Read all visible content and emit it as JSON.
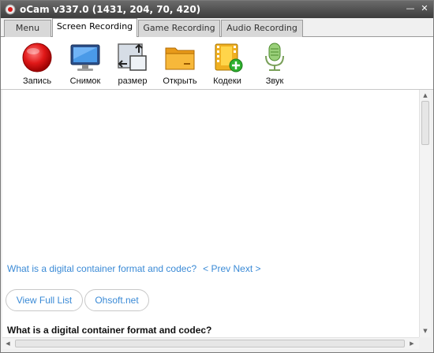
{
  "window": {
    "title": "oCam v337.0 (1431, 204, 70, 420)",
    "minimize_glyph": "—",
    "close_glyph": "✕",
    "icon": "ocam-app-icon"
  },
  "tabs": [
    {
      "label": "Menu",
      "active": false
    },
    {
      "label": "Screen Recording",
      "active": true
    },
    {
      "label": "Game Recording",
      "active": false
    },
    {
      "label": "Audio Recording",
      "active": false
    }
  ],
  "toolbar": {
    "items": [
      {
        "label": "Запись",
        "icon": "record-icon"
      },
      {
        "label": "Снимок",
        "icon": "monitor-icon"
      },
      {
        "label": "размер",
        "icon": "resize-icon"
      },
      {
        "label": "Открыть",
        "icon": "folder-icon"
      },
      {
        "label": "Кодеки",
        "icon": "codec-icon"
      },
      {
        "label": "Звук",
        "icon": "microphone-icon"
      }
    ]
  },
  "content": {
    "faq_link": "What is a digital container format and codec?",
    "prev_next": "< Prev Next >",
    "view_full_list": "View Full List",
    "ohsoft": "Ohsoft.net",
    "heading": "What is a digital container format and codec?"
  },
  "colors": {
    "link": "#3a8ad6",
    "titlebar": "#4a4a4a",
    "record_red": "#d81818"
  }
}
